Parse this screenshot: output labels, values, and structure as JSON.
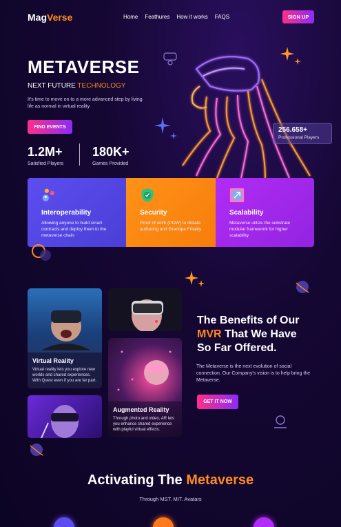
{
  "nav": {
    "logo_main": "MagVerse",
    "items": [
      "Home",
      "Feathures",
      "How it works",
      "FAQS"
    ],
    "signup": "SIGN UP"
  },
  "hero": {
    "title": "METAVERSE",
    "subtitle_prefix": "NEXT FUTURE ",
    "subtitle_highlight": "TECHNOLOGY",
    "description": "It's time to move on to a more advanced step by living life as normal in virtual reality",
    "cta": "FIND EVENTS",
    "stats": [
      {
        "value": "1.2M+",
        "label": "Satisfied Players"
      },
      {
        "value": "180K+",
        "label": "Games Provided"
      }
    ],
    "badge": {
      "value": "256.658+",
      "label": "Professional Players"
    }
  },
  "features": [
    {
      "title": "Interoperability",
      "text": "Allowing anyone to build smart contracts and deploy them to the metaverse chain"
    },
    {
      "title": "Security",
      "text": "Proof of work (POW) to dictate authoring and Grandpa Finality"
    },
    {
      "title": "Scalability",
      "text": "Metaverse utilize the substrate modular framework for higher scalability"
    }
  ],
  "cards": [
    {
      "title": "Virtual Reality",
      "text": "Virtual reality lets you explore new worlds and shared experiences. With Quest even if you are far part."
    },
    {
      "title": "Augmented Reality",
      "text": "Through photo and video, AR lets you enhance shared experience with playful virtual effects."
    }
  ],
  "benefits": {
    "line1": "The Benefits of Our",
    "highlight": "MVR",
    "line2": " That We Have",
    "line3": "So Far Offered.",
    "description": "The Metaverse is the next evolution of social connection. Our Company's vision is to help bring the Metaverse.",
    "cta": "GET IT NOW"
  },
  "activating": {
    "title_prefix": "Activating The ",
    "title_highlight": "Metaverse",
    "subtitle": "Through MST. MIT. Avatars"
  },
  "colors": {
    "accent": "#ff8a1f",
    "pink": "#ff2e8a",
    "purple": "#8b2cf5",
    "blue": "#5d4df0",
    "orange": "#ff9217",
    "violet": "#b12cf5"
  }
}
